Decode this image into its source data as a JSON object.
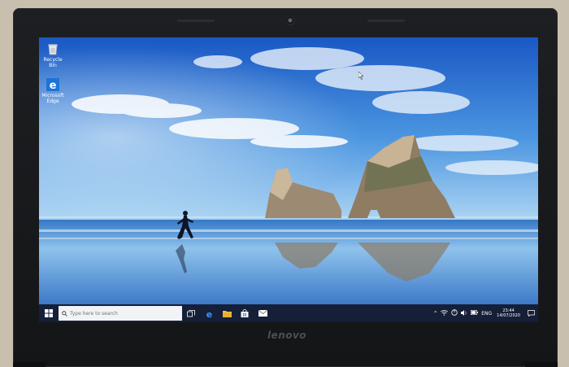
{
  "laptop": {
    "brand": "lenovo"
  },
  "desktop": {
    "icons": [
      {
        "label": "Recycle Bin"
      },
      {
        "label": "Microsoft Edge"
      }
    ]
  },
  "taskbar": {
    "search_placeholder": "Type here to search",
    "apps": [
      "task-view",
      "edge",
      "file-explorer",
      "store",
      "mail"
    ],
    "tray": {
      "language": "ENG",
      "time": "23:44",
      "date": "14/07/2020"
    }
  },
  "colors": {
    "sky_top": "#1f5fc8",
    "sky_bottom": "#9ccbf0",
    "sea": "#2e6fc0",
    "taskbar": "#141c30"
  }
}
